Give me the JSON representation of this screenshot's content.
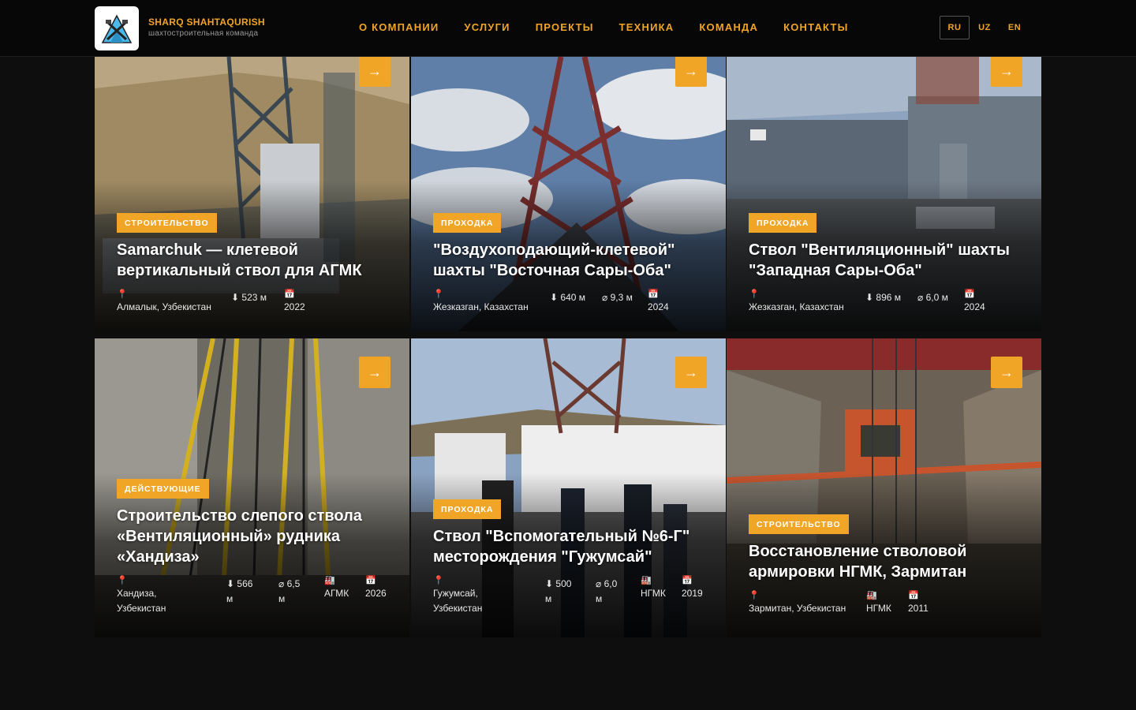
{
  "header": {
    "brand_name": "SHARQ SHAHTAQURISH",
    "brand_sub": "шахтостроительная команда",
    "nav": [
      "О КОМПАНИИ",
      "УСЛУГИ",
      "ПРОЕКТЫ",
      "ТЕХНИКА",
      "КОМАНДА",
      "КОНТАКТЫ"
    ],
    "langs": [
      "RU",
      "UZ",
      "EN"
    ],
    "active_lang": "RU"
  },
  "icons": {
    "arrow": "→",
    "location": "map-pin-icon",
    "depth": "⬇",
    "diameter": "⌀",
    "calendar": "calendar-icon",
    "factory": "factory-icon"
  },
  "colors": {
    "accent": "#f0a526",
    "background": "#0e0e0f",
    "header": "#070707"
  },
  "projects": [
    {
      "category": "СТРОИТЕЛЬСТВО",
      "title": "Samarchuk — клетевой вертикальный ствол для АГМК",
      "location": "Алмалык, Узбекистан",
      "depth": "523 м",
      "year": "2022"
    },
    {
      "category": "ПРОХОДКА",
      "title": "\"Воздухоподающий-клетевой\" шахты \"Восточная Сары-Оба\"",
      "location": "Жезказган, Казахстан",
      "depth": "640 м",
      "diameter": "9,3 м",
      "year": "2024"
    },
    {
      "category": "ПРОХОДКА",
      "title": "Ствол \"Вентиляционный\" шахты \"Западная Сары-Оба\"",
      "location": "Жезказган, Казахстан",
      "depth": "896 м",
      "diameter": "6,0 м",
      "year": "2024"
    },
    {
      "category": "ДЕЙСТВУЮЩИЕ",
      "title": "Строительство слепого ствола «Вентиляционный» рудника «Хандиза»",
      "location_l1": "Хандиза,",
      "location_l2": "Узбекистан",
      "depth_num": "566",
      "depth_unit": "м",
      "diameter_num": "6,5",
      "diameter_unit": "м",
      "client": "АГМК",
      "year": "2026"
    },
    {
      "category": "ПРОХОДКА",
      "title": "Ствол \"Вспомогательный №6-Г\" месторождения \"Гужумсай\"",
      "location_l1": "Гужумсай,",
      "location_l2": "Узбекистан",
      "depth_num": "500",
      "depth_unit": "м",
      "diameter_num": "6,0",
      "diameter_unit": "м",
      "client": "НГМК",
      "year": "2019"
    },
    {
      "category": "СТРОИТЕЛЬСТВО",
      "title": "Восстановление стволовой армировки НГМК, Зармитан",
      "location": "Зармитан, Узбекистан",
      "client": "НГМК",
      "year": "2011"
    }
  ]
}
